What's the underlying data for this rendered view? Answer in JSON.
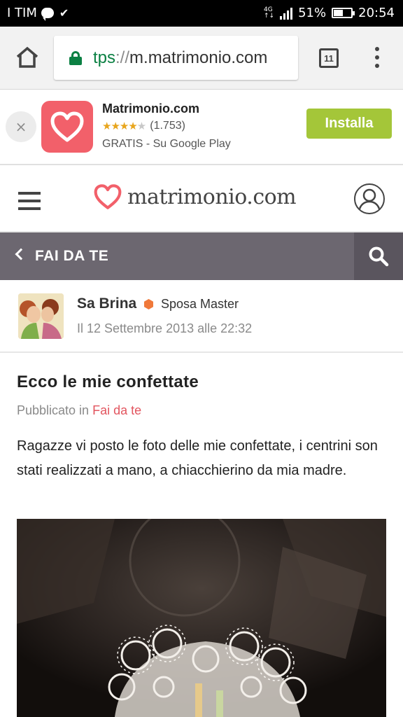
{
  "status_bar": {
    "carrier": "I TIM",
    "network": "4G",
    "battery": "51%",
    "time": "20:54"
  },
  "browser": {
    "url_scheme": "tps",
    "url_separator": "://",
    "url_host": "m.matrimonio.com",
    "tab_count": "11"
  },
  "app_banner": {
    "close_symbol": "×",
    "app_name": "Matrimonio.com",
    "rating_count": "(1.753)",
    "rating_value": 4.5,
    "subtitle": "GRATIS - Su Google Play",
    "install_label": "Installa"
  },
  "site_header": {
    "logo_text": "matrimonio.com"
  },
  "section": {
    "title": "FAI DA TE"
  },
  "author": {
    "name": "Sa Brina",
    "rank": "Sposa Master",
    "date": "Il 12 Settembre 2013 alle 22:32"
  },
  "post": {
    "title": "Ecco le mie confettate",
    "published_prefix": "Pubblicato in ",
    "category": "Fai da te",
    "body": "Ragazze vi posto le foto delle mie confettate, i centrini son stati realizzati a mano, a chiacchierino da mia madre."
  },
  "colors": {
    "brand_red": "#f2606a",
    "install_green": "#a4c639",
    "section_bar": "#6c6770",
    "link_red": "#e2555f",
    "secure_green": "#0b8043"
  }
}
